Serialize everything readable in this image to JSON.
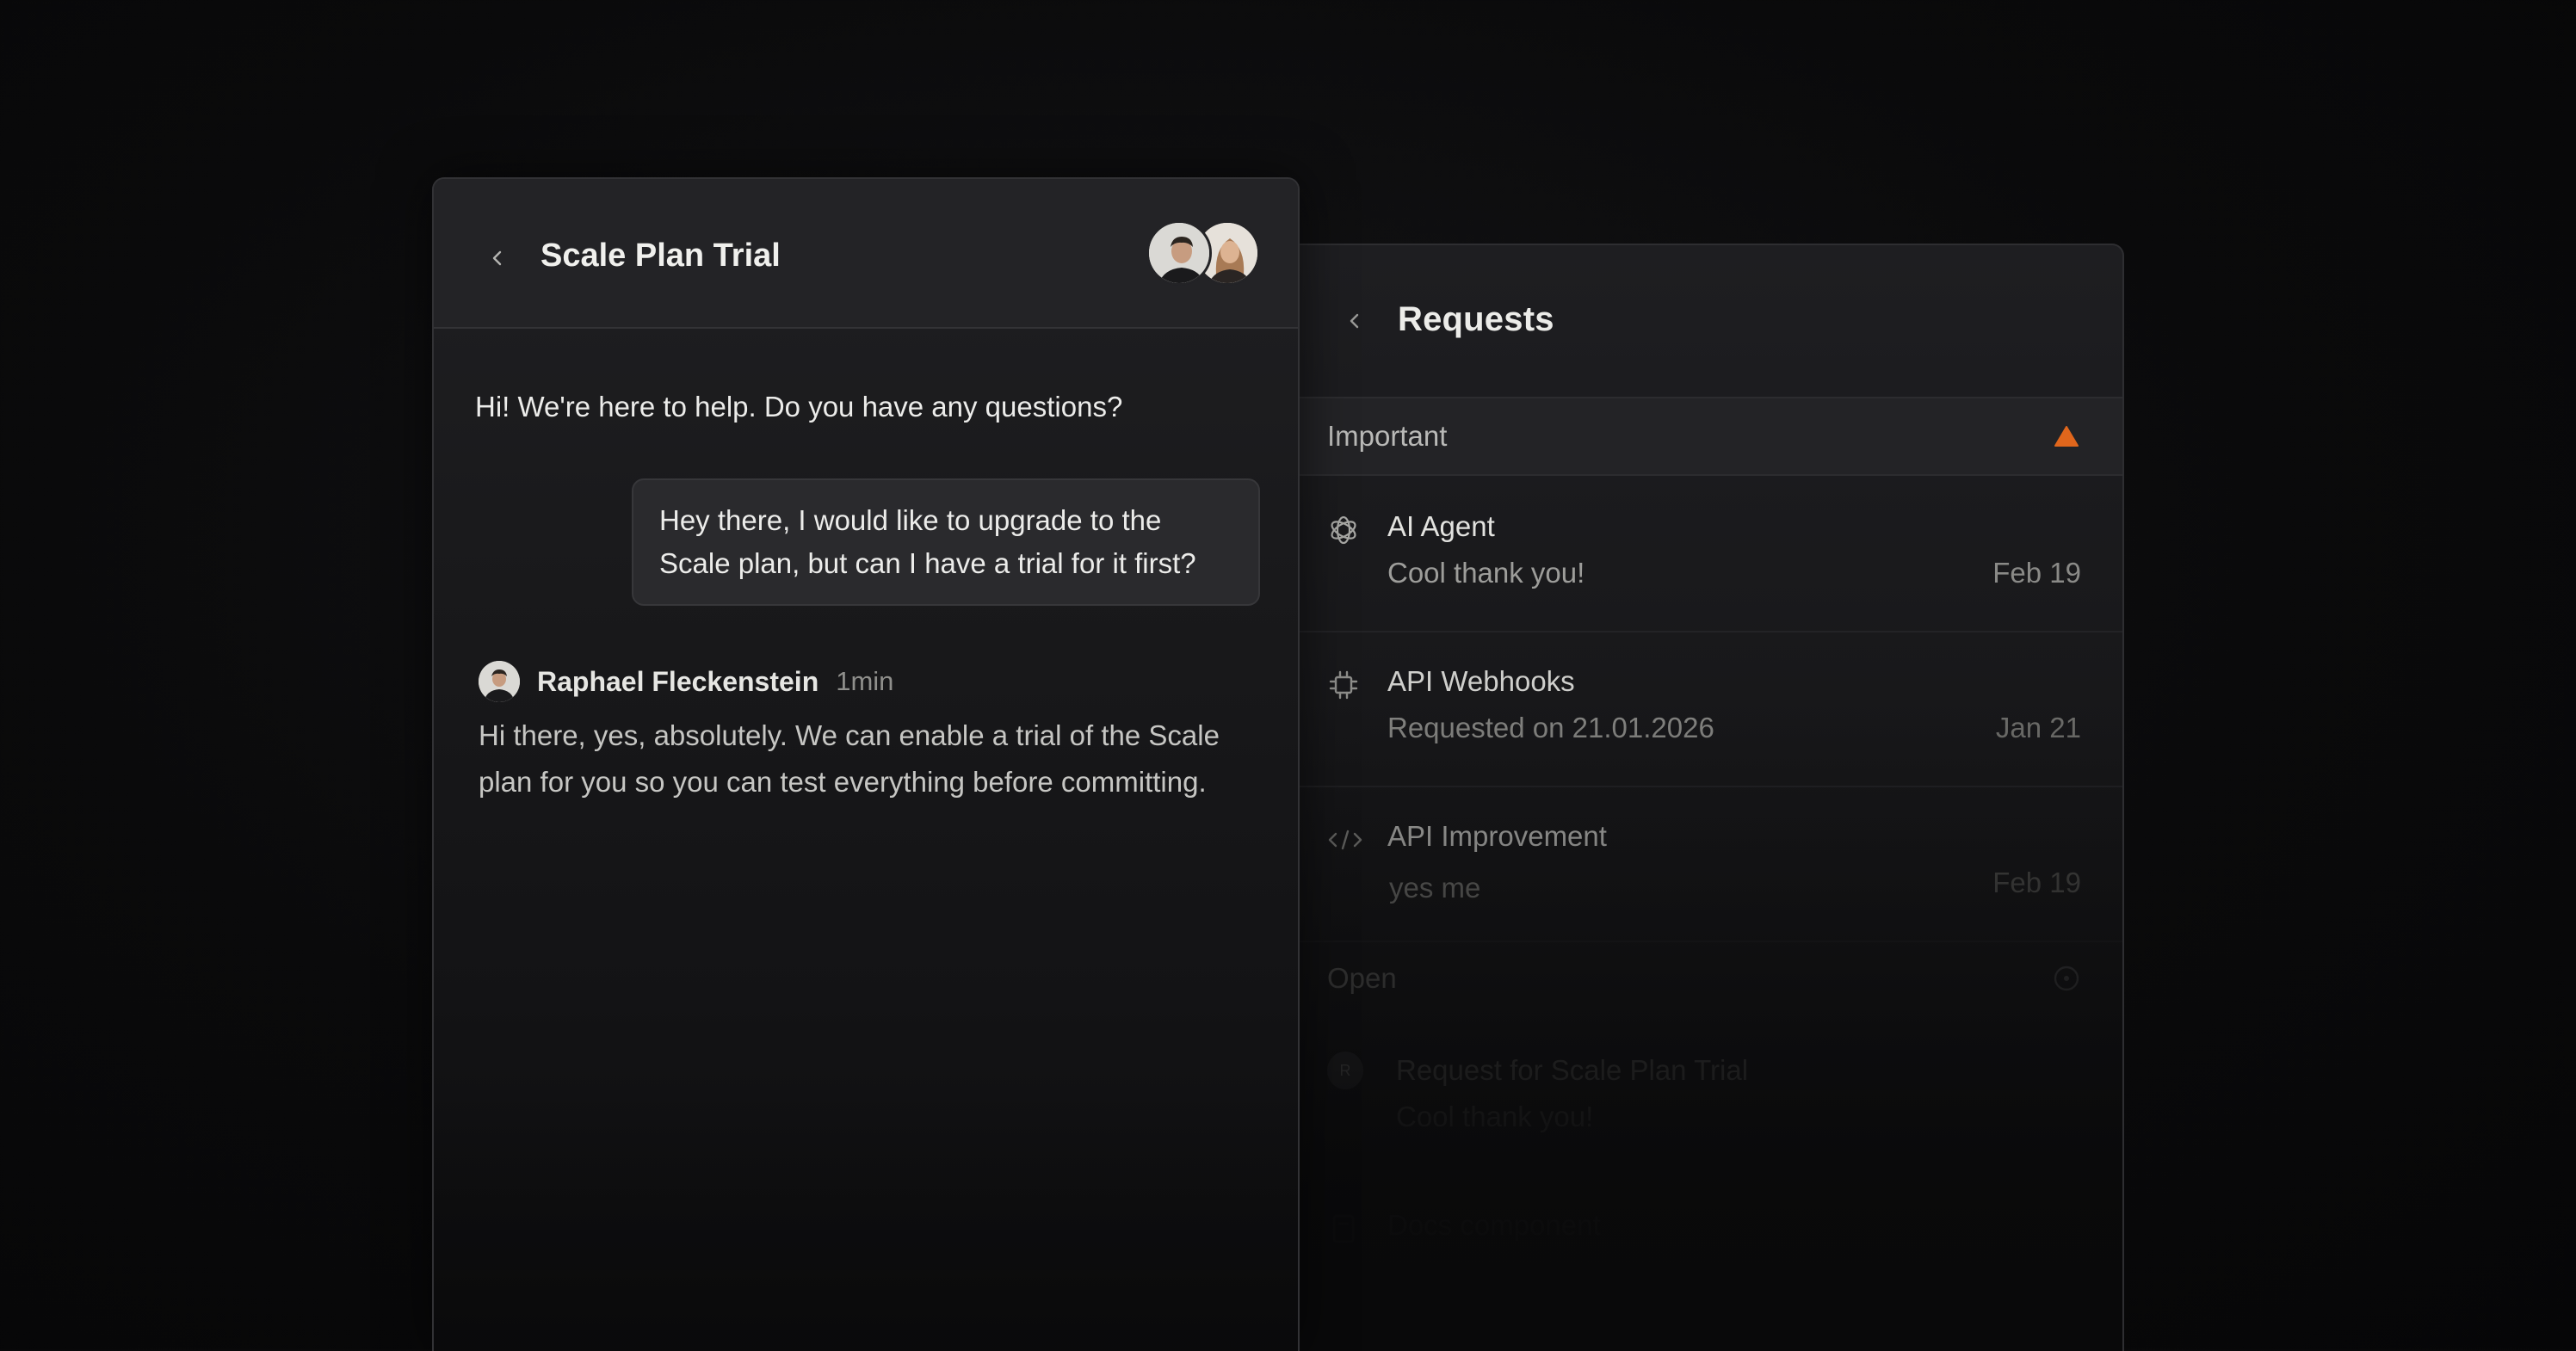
{
  "requests": {
    "title": "Requests",
    "sections": [
      {
        "label": "Important",
        "icon": "warning-triangle-icon",
        "icon_color": "#e0661c"
      },
      {
        "label": "Open",
        "icon": "open-circle-icon"
      }
    ],
    "important_items": [
      {
        "title": "AI Agent",
        "subtitle": "Cool thank you!",
        "date": "Feb 19",
        "icon": "openai-icon"
      },
      {
        "title": "API Webhooks",
        "subtitle": "Requested on 21.01.2026",
        "date": "Jan 21",
        "icon": "chip-icon"
      },
      {
        "title": "API Improvement",
        "subtitle": "yes me",
        "date": "Feb 19",
        "icon": "code-icon"
      }
    ],
    "open_items": [
      {
        "title": "Request for Scale Plan Trial",
        "subtitle": "Cool thank you!",
        "icon": "avatar-letter-icon",
        "avatar_letter": "R"
      },
      {
        "title": "Docs component",
        "icon": "document-icon"
      }
    ]
  },
  "chat": {
    "title": "Scale Plan Trial",
    "greeting": "Hi! We're here to help. Do you have any questions?",
    "user_message": "Hey there, I would like to upgrade to the Scale plan, but can I have a trial for it first?",
    "agent": {
      "name": "Raphael Fleckenstein",
      "time": "1min",
      "message": "Hi there, yes, absolutely. We can enable a trial of the Scale plan for you so you can test everything before committing."
    }
  },
  "colors": {
    "accent_warning": "#e0661c",
    "background": "#0a0a0b",
    "panel": "#1f1f22"
  }
}
